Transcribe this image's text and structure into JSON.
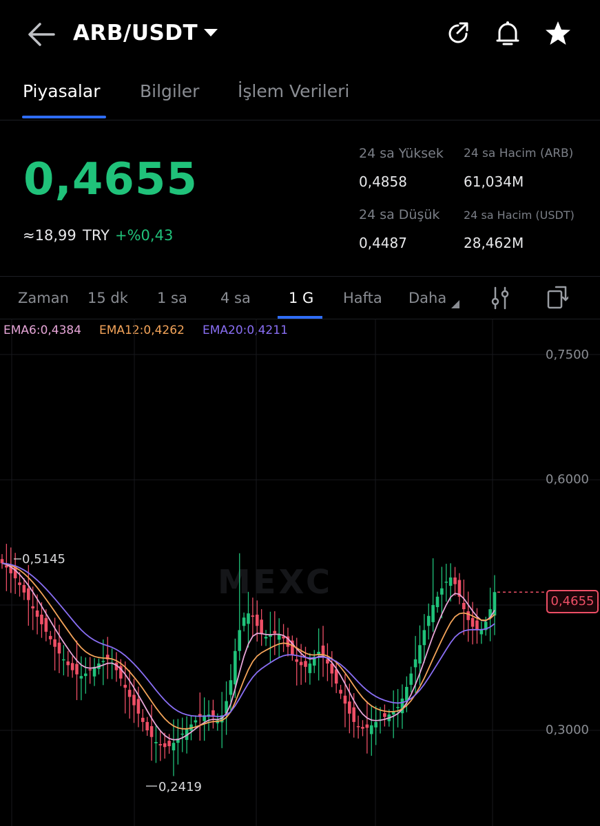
{
  "header": {
    "pair": "ARB/USDT"
  },
  "tabs": [
    {
      "label": "Piyasalar",
      "active": true
    },
    {
      "label": "Bilgiler",
      "active": false
    },
    {
      "label": "İşlem Verileri",
      "active": false
    }
  ],
  "ticker": {
    "price": "0,4655",
    "fiat_approx": "≈18,99",
    "fiat_currency": "TRY",
    "change": "+%0,43",
    "stats": {
      "high_label": "24 sa Yüksek",
      "high_value": "0,4858",
      "vol_arb_label": "24 sa Hacim (ARB)",
      "vol_arb_value": "61,034M",
      "low_label": "24 sa Düşük",
      "low_value": "0,4487",
      "vol_usdt_label": "24 sa Hacim  (USDT)",
      "vol_usdt_value": "28,462M"
    }
  },
  "timeframes": {
    "items": [
      "Zaman",
      "15 dk",
      "1 sa",
      "4 sa",
      "1 G",
      "Hafta",
      "Daha"
    ],
    "active": "1 G"
  },
  "indicators": {
    "ema6": "EMA6:0,4384",
    "ema12": "EMA12:0,4262",
    "ema20": "EMA20:0,4211"
  },
  "watermark": "MEXC",
  "colors": {
    "up": "#20c27a",
    "down": "#ee4f66",
    "accent": "#2f6df6",
    "ema6": "#e7a6d8",
    "ema12": "#f5a55a",
    "ema20": "#8a6ff5"
  },
  "chart_data": {
    "type": "candlestick",
    "interval": "1 G",
    "yticks": [
      "0,7500",
      "0,6000",
      "0,3000"
    ],
    "ytick_values": [
      0.75,
      0.6,
      0.3
    ],
    "last_price_label": "0,4655",
    "last_price": 0.4655,
    "high_annotation": "0,5145",
    "low_annotation": "0,2419",
    "close": [
      0.5,
      0.495,
      0.488,
      0.482,
      0.474,
      0.465,
      0.456,
      0.446,
      0.436,
      0.427,
      0.418,
      0.409,
      0.4,
      0.392,
      0.385,
      0.378,
      0.372,
      0.367,
      0.365,
      0.368,
      0.372,
      0.376,
      0.38,
      0.383,
      0.385,
      0.381,
      0.372,
      0.362,
      0.351,
      0.34,
      0.33,
      0.32,
      0.31,
      0.3,
      0.292,
      0.286,
      0.282,
      0.28,
      0.281,
      0.285,
      0.29,
      0.296,
      0.302,
      0.307,
      0.312,
      0.316,
      0.318,
      0.319,
      0.316,
      0.312,
      0.318,
      0.335,
      0.36,
      0.395,
      0.42,
      0.435,
      0.44,
      0.436,
      0.425,
      0.415,
      0.412,
      0.414,
      0.416,
      0.415,
      0.41,
      0.4,
      0.39,
      0.382,
      0.378,
      0.376,
      0.38,
      0.388,
      0.394,
      0.39,
      0.38,
      0.368,
      0.356,
      0.344,
      0.332,
      0.32,
      0.31,
      0.304,
      0.302,
      0.303,
      0.306,
      0.31,
      0.313,
      0.316,
      0.319,
      0.322,
      0.328,
      0.338,
      0.352,
      0.368,
      0.385,
      0.402,
      0.42,
      0.437,
      0.45,
      0.46,
      0.47,
      0.478,
      0.483,
      0.475,
      0.46,
      0.445,
      0.432,
      0.424,
      0.42,
      0.42,
      0.43,
      0.445,
      0.4655
    ],
    "ema6_end": 0.4384,
    "ema12_end": 0.4262,
    "ema20_end": 0.4211
  }
}
